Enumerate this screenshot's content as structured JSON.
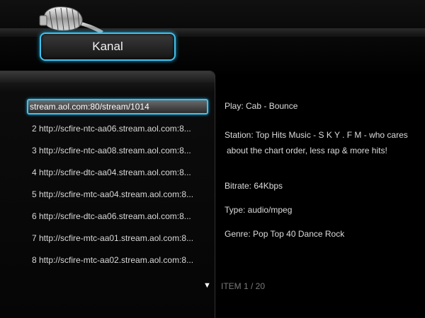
{
  "header": {
    "title": "Kanal"
  },
  "stream_list": {
    "items": [
      {
        "label": "stream.aol.com:80/stream/1014",
        "selected": true
      },
      {
        "label": "2 http://scfire-ntc-aa06.stream.aol.com:8..."
      },
      {
        "label": "3 http://scfire-ntc-aa08.stream.aol.com:8..."
      },
      {
        "label": "4 http://scfire-dtc-aa04.stream.aol.com:8..."
      },
      {
        "label": "5 http://scfire-mtc-aa04.stream.aol.com:8..."
      },
      {
        "label": "6 http://scfire-dtc-aa06.stream.aol.com:8..."
      },
      {
        "label": "7 http://scfire-mtc-aa01.stream.aol.com:8..."
      },
      {
        "label": "8 http://scfire-mtc-aa02.stream.aol.com:8..."
      }
    ],
    "scroll_arrow": "▼",
    "item_counter": "ITEM 1 / 20"
  },
  "details": {
    "play": "Play: Cab - Bounce",
    "station_line1": "Station:  Top Hits Music - S K Y . F M - who cares",
    "station_line2": "about the chart order, less rap & more hits!",
    "bitrate": "Bitrate:  64Kbps",
    "type": "Type:  audio/mpeg",
    "genre": "Genre:  Pop Top 40 Dance Rock"
  },
  "colors": {
    "accent": "#3fc2ee",
    "background": "#000000"
  },
  "icons": {
    "logo": "microphone-icon",
    "scroll": "triangle-down-icon"
  }
}
